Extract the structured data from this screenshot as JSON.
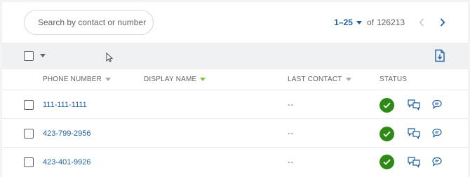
{
  "search": {
    "placeholder": "Search by contact or number"
  },
  "pagination": {
    "range": "1–25",
    "of": "of",
    "total": "126213"
  },
  "columns": {
    "phone_number": "PHONE NUMBER",
    "display_name": "DISPLAY NAME",
    "last_contact": "LAST CONTACT",
    "status": "STATUS"
  },
  "rows": [
    {
      "phone": "111-111-1111",
      "display_name": "",
      "last_contact": "--"
    },
    {
      "phone": "423-799-2956",
      "display_name": "",
      "last_contact": "--"
    },
    {
      "phone": "423-401-9926",
      "display_name": "",
      "last_contact": "--"
    }
  ],
  "colors": {
    "accent": "#1f5f9e",
    "status_ok": "#2e8a17",
    "sort_active": "#7cc242"
  },
  "icons": [
    "chevron-left-icon",
    "chevron-right-icon",
    "export-icon",
    "checkmark-icon",
    "conversation-icon",
    "message-icon",
    "mouse-pointer-icon"
  ]
}
